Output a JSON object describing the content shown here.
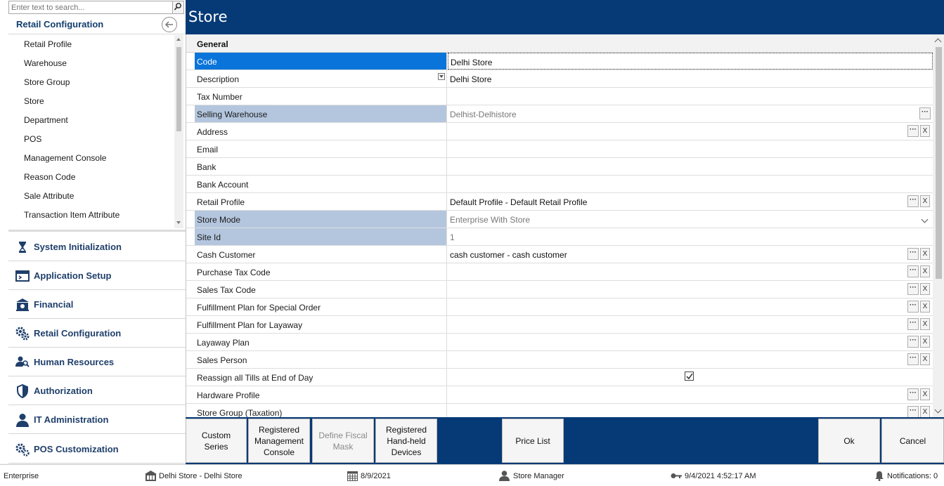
{
  "search": {
    "placeholder": "Enter text to search..."
  },
  "nav": {
    "header": "Retail Configuration",
    "sub_items": [
      "Retail Profile",
      "Warehouse",
      "Store Group",
      "Store",
      "Department",
      "POS",
      "Management Console",
      "Reason Code",
      "Sale Attribute",
      "Transaction Item Attribute"
    ],
    "modules": [
      {
        "label": "System Initialization",
        "icon": "hourglass-icon"
      },
      {
        "label": "Application Setup",
        "icon": "window-icon"
      },
      {
        "label": "Financial",
        "icon": "bank-icon"
      },
      {
        "label": "Retail Configuration",
        "icon": "gears-icon"
      },
      {
        "label": "Human Resources",
        "icon": "people-search-icon"
      },
      {
        "label": "Authorization",
        "icon": "shield-icon"
      },
      {
        "label": "IT Administration",
        "icon": "user-icon"
      },
      {
        "label": "POS Customization",
        "icon": "cogs-icon"
      }
    ]
  },
  "page": {
    "title": "Store",
    "section": "General"
  },
  "fields": [
    {
      "label": "Code",
      "value": "Delhi Store",
      "state": "selected"
    },
    {
      "label": "Description",
      "value": "Delhi Store"
    },
    {
      "label": "Tax Number",
      "value": ""
    },
    {
      "label": "Selling Warehouse",
      "value": "Delhist-Delhistore",
      "state": "readonly"
    },
    {
      "label": "Address",
      "value": ""
    },
    {
      "label": "Email",
      "value": ""
    },
    {
      "label": "Bank",
      "value": ""
    },
    {
      "label": "Bank Account",
      "value": ""
    },
    {
      "label": "Retail Profile",
      "value": "Default Profile - Default Retail Profile"
    },
    {
      "label": "Store Mode",
      "value": "Enterprise With Store",
      "state": "readonly"
    },
    {
      "label": "Site Id",
      "value": "1",
      "state": "readonly"
    },
    {
      "label": "Cash Customer",
      "value": "cash customer - cash customer"
    },
    {
      "label": "Purchase Tax Code",
      "value": ""
    },
    {
      "label": "Sales Tax Code",
      "value": ""
    },
    {
      "label": "Fulfillment Plan for Special Order",
      "value": ""
    },
    {
      "label": "Fulfillment Plan for Layaway",
      "value": ""
    },
    {
      "label": "Layaway Plan",
      "value": ""
    },
    {
      "label": "Sales Person",
      "value": ""
    },
    {
      "label": "Reassign all Tills at End of Day",
      "value": ""
    },
    {
      "label": "Hardware Profile",
      "value": ""
    },
    {
      "label": "Store Group (Taxation)",
      "value": ""
    }
  ],
  "toolbar": {
    "custom_series": "Custom\nSeries",
    "registered_mc": "Registered\nManagement\nConsole",
    "define_fiscal": "Define Fiscal\nMask",
    "registered_hh": "Registered\nHand-held\nDevices",
    "price_list": "Price List",
    "ok": "Ok",
    "cancel": "Cancel"
  },
  "status": {
    "company": "Enterprise",
    "store": "Delhi Store - Delhi Store",
    "date": "8/9/2021",
    "user": "Store Manager",
    "login_time": "9/4/2021 4:52:17 AM",
    "notifications": "Notifications: 0"
  },
  "colors": {
    "header_blue": "#063a76",
    "selection_blue": "#0a74da",
    "readonly_label": "#b4c6de"
  }
}
